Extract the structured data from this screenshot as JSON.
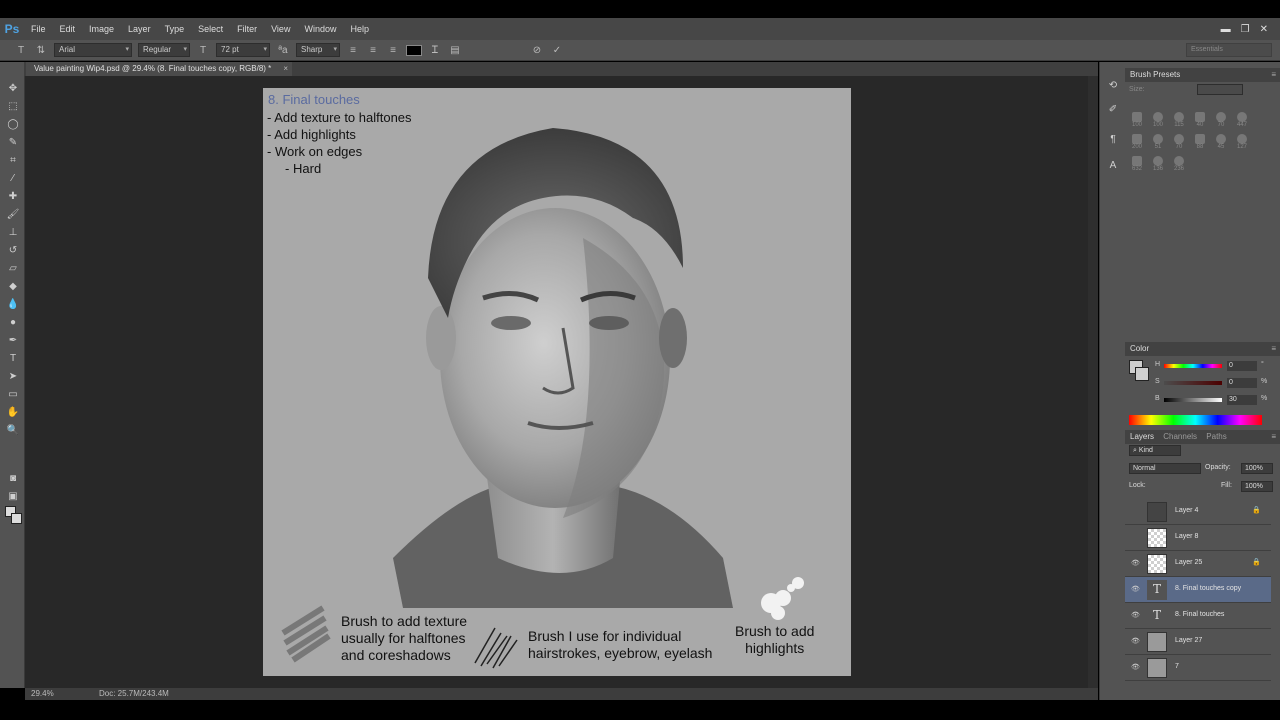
{
  "app": {
    "logo": "Ps"
  },
  "menu": [
    "File",
    "Edit",
    "Image",
    "Layer",
    "Type",
    "Select",
    "Filter",
    "View",
    "Window",
    "Help"
  ],
  "window_controls": {
    "minimize": "▬",
    "restore": "❐",
    "close": "✕"
  },
  "options": {
    "font_family": "Arial",
    "font_style": "Regular",
    "font_size": "72 pt",
    "antialias_label": "ªa",
    "antialias": "Sharp",
    "workspace": "Essentials",
    "text_color": "#000000"
  },
  "document": {
    "tab_title": "Value painting Wip4.psd @ 29.4% (8. Final touches copy, RGB/8) *",
    "close": "×"
  },
  "canvas_text": {
    "title": "8. Final touches",
    "lines": [
      "- Add texture to halftones",
      "- Add highlights",
      "- Work on edges",
      "     - Hard"
    ],
    "brush1": [
      "Brush to add texture",
      "usually for halftones",
      "and coreshadows"
    ],
    "brush2": [
      "Brush I use for individual",
      "hairstrokes, eyebrow, eyelash"
    ],
    "brush3": [
      "Brush to add",
      "highlights"
    ]
  },
  "status": {
    "zoom": "29.4%",
    "doc_size": "Doc: 25.7M/243.4M"
  },
  "panels": {
    "brush_presets": {
      "title": "Brush Presets",
      "size_label": "Size:",
      "sizes": [
        "100",
        "100",
        "115",
        "40",
        "70",
        "447",
        "200",
        "51",
        "70",
        "88",
        "45",
        "127",
        "632",
        "136",
        "236"
      ]
    },
    "color": {
      "title": "Color",
      "h_label": "H",
      "h_value": "0",
      "h_unit": "°",
      "s_label": "S",
      "s_value": "0",
      "s_unit": "%",
      "b_label": "B",
      "b_value": "30",
      "b_unit": "%"
    },
    "layers": {
      "tabs": [
        "Layers",
        "Channels",
        "Paths"
      ],
      "kind": "Kind",
      "blend_mode": "Normal",
      "opacity_label": "Opacity:",
      "opacity": "100%",
      "lock_label": "Lock:",
      "fill_label": "Fill:",
      "fill": "100%",
      "items": [
        {
          "name": "Layer 4",
          "thumb": "dark",
          "visible": false,
          "locked": true
        },
        {
          "name": "Layer 8",
          "thumb": "check",
          "visible": false,
          "locked": false
        },
        {
          "name": "Layer 25",
          "thumb": "check",
          "visible": true,
          "locked": true
        },
        {
          "name": "8. Final touches copy",
          "thumb": "text",
          "visible": true,
          "locked": false,
          "selected": true
        },
        {
          "name": "8. Final touches",
          "thumb": "text",
          "visible": true,
          "locked": false
        },
        {
          "name": "Layer 27",
          "thumb": "face",
          "visible": true,
          "locked": false
        },
        {
          "name": "7",
          "thumb": "face",
          "visible": true,
          "locked": false
        }
      ]
    }
  }
}
